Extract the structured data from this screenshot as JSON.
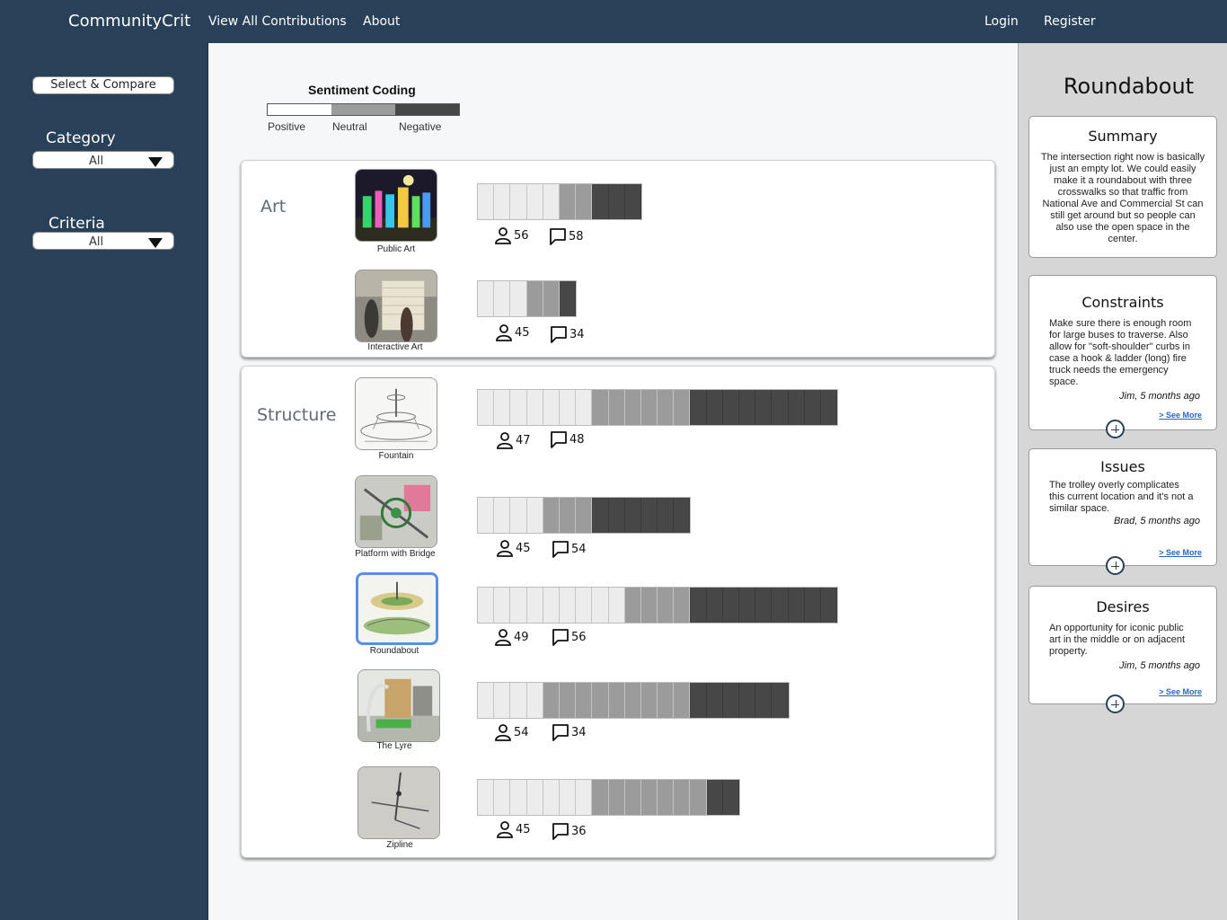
{
  "nav": {
    "brand": "CommunityCrit",
    "view_all": "View All Contributions",
    "about": "About",
    "login": "Login",
    "register": "Register"
  },
  "sidebar": {
    "compare_button": "Select & Compare",
    "category_label": "Category",
    "category_value": "All",
    "criteria_label": "Criteria",
    "criteria_value": "All"
  },
  "legend": {
    "title": "Sentiment Coding",
    "positive": "Positive",
    "neutral": "Neutral",
    "negative": "Negative"
  },
  "colors": {
    "navy": "#284159",
    "positive": "#ececec",
    "neutral": "#9b9b9b",
    "negative": "#474747",
    "selected": "#5b8fe3",
    "link": "#2a66c7"
  },
  "groups": [
    {
      "label": "Art",
      "items": [
        {
          "caption": "Public Art",
          "positive": 5,
          "neutral": 2,
          "negative": 3,
          "people": "56",
          "comments": "58",
          "selected": false
        },
        {
          "caption": "Interactive Art",
          "positive": 3,
          "neutral": 2,
          "negative": 1,
          "people": "45",
          "comments": "34",
          "selected": false
        }
      ]
    },
    {
      "label": "Structure",
      "items": [
        {
          "caption": "Fountain",
          "positive": 7,
          "neutral": 6,
          "negative": 9,
          "people": "47",
          "comments": "48",
          "selected": false
        },
        {
          "caption": "Platform with Bridge",
          "positive": 4,
          "neutral": 3,
          "negative": 6,
          "people": "45",
          "comments": "54",
          "selected": false
        },
        {
          "caption": "Roundabout",
          "positive": 9,
          "neutral": 4,
          "negative": 9,
          "people": "49",
          "comments": "56",
          "selected": true
        },
        {
          "caption": "The Lyre",
          "positive": 4,
          "neutral": 9,
          "negative": 6,
          "people": "54",
          "comments": "34",
          "selected": false
        },
        {
          "caption": "Zipline",
          "positive": 7,
          "neutral": 7,
          "negative": 2,
          "people": "45",
          "comments": "36",
          "selected": false
        }
      ]
    }
  ],
  "panel": {
    "title": "Roundabout",
    "summary": {
      "heading": "Summary",
      "text": "The intersection right now is basically just an empty lot. We could easily make it a roundabout with three crosswalks so that traffic from National Ave and Commercial St can still get around but so people can also use the open space in the center."
    },
    "constraints": {
      "heading": "Constraints",
      "text": "Make sure there is enough room for large buses to traverse. Also allow for \"soft-shoulder\" curbs in case a hook & ladder (long) fire truck needs the emergency space.",
      "meta": "Jim, 5 months ago",
      "see_more": "> See More"
    },
    "issues": {
      "heading": "Issues",
      "text": "The trolley overly complicates this current location and it's not a similar space.",
      "meta": "Brad, 5 months ago",
      "see_more": "> See More"
    },
    "desires": {
      "heading": "Desires",
      "text": "An opportunity for iconic public art in the middle or on adjacent property.",
      "meta": "Jim, 5 months ago",
      "see_more": "> See More"
    }
  }
}
